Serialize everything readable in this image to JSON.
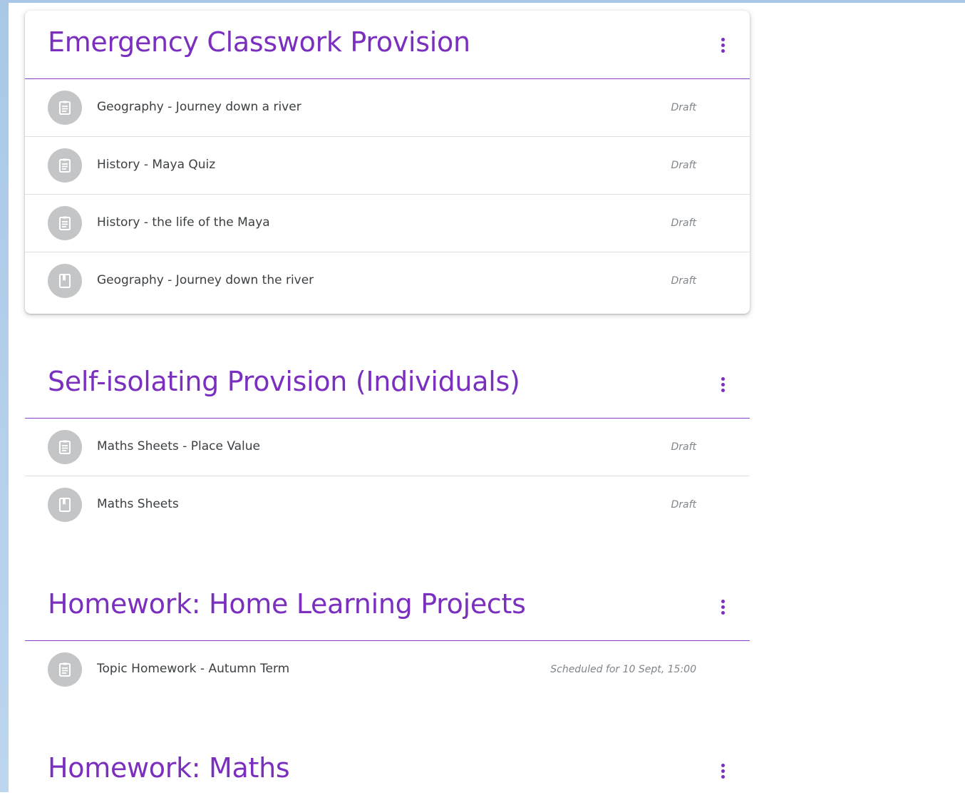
{
  "topics": [
    {
      "title": "Emergency Classwork Provision",
      "items": [
        {
          "title": "Geography - Journey down a river",
          "status": "Draft",
          "icon": "assignment-icon"
        },
        {
          "title": "History - Maya Quiz",
          "status": "Draft",
          "icon": "assignment-icon"
        },
        {
          "title": "History - the life of the Maya",
          "status": "Draft",
          "icon": "assignment-icon"
        },
        {
          "title": "Geography - Journey down the river",
          "status": "Draft",
          "icon": "material-icon"
        }
      ]
    },
    {
      "title": "Self-isolating Provision (Individuals)",
      "items": [
        {
          "title": "Maths Sheets - Place Value",
          "status": "Draft",
          "icon": "assignment-icon"
        },
        {
          "title": "Maths Sheets",
          "status": "Draft",
          "icon": "material-icon"
        }
      ]
    },
    {
      "title": "Homework: Home Learning Projects",
      "items": [
        {
          "title": "Topic Homework - Autumn Term",
          "status": "Scheduled for 10 Sept, 15:00",
          "icon": "assignment-icon"
        }
      ]
    },
    {
      "title": "Homework: Maths",
      "items": []
    }
  ],
  "colors": {
    "accent": "#7b2fbf",
    "divider": "#8e3dc7",
    "icon_bg": "#c4c5c7",
    "status_text": "#80868b"
  }
}
